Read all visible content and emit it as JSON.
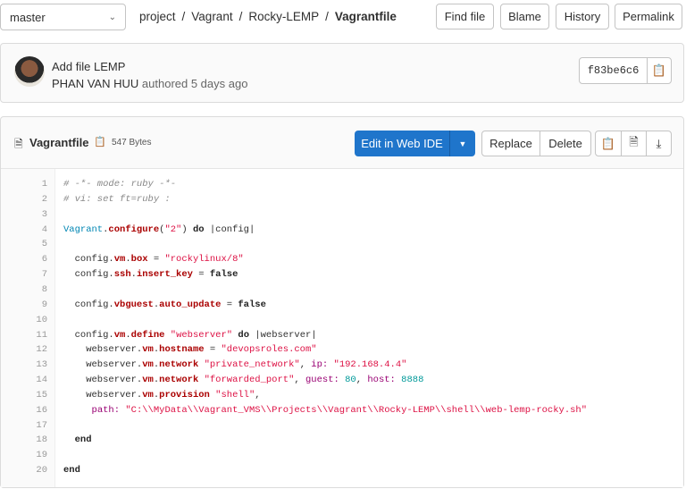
{
  "branch": {
    "value": "master"
  },
  "breadcrumb": [
    "project",
    "Vagrant",
    "Rocky-LEMP",
    "Vagrantfile"
  ],
  "toolbar": {
    "find_file": "Find file",
    "blame": "Blame",
    "history": "History",
    "permalink": "Permalink"
  },
  "commit": {
    "title": "Add file LEMP",
    "author": "PHAN VAN HUU",
    "meta": "authored 5 days ago",
    "sha": "f83be6c6"
  },
  "file": {
    "name": "Vagrantfile",
    "size": "547 Bytes",
    "edit_label": "Edit in Web IDE",
    "replace_label": "Replace",
    "delete_label": "Delete"
  },
  "code": {
    "lines": [
      [
        [
          "c",
          "# -*- mode: ruby -*-"
        ]
      ],
      [
        [
          "c",
          "# vi: set ft=ruby :"
        ]
      ],
      [],
      [
        [
          "n",
          "Vagrant"
        ],
        [
          "p",
          "."
        ],
        [
          "m",
          "configure"
        ],
        [
          "p",
          "("
        ],
        [
          "s",
          "\"2\""
        ],
        [
          "p",
          ") "
        ],
        [
          "k",
          "do"
        ],
        [
          "p",
          " |config|"
        ]
      ],
      [],
      [
        [
          "p",
          "  config."
        ],
        [
          "m",
          "vm"
        ],
        [
          "p",
          "."
        ],
        [
          "m",
          "box"
        ],
        [
          "p",
          " = "
        ],
        [
          "s",
          "\"rockylinux/8\""
        ]
      ],
      [
        [
          "p",
          "  config."
        ],
        [
          "m",
          "ssh"
        ],
        [
          "p",
          "."
        ],
        [
          "m",
          "insert_key"
        ],
        [
          "p",
          " = "
        ],
        [
          "k",
          "false"
        ]
      ],
      [],
      [
        [
          "p",
          "  config."
        ],
        [
          "m",
          "vbguest"
        ],
        [
          "p",
          "."
        ],
        [
          "m",
          "auto_update"
        ],
        [
          "p",
          " = "
        ],
        [
          "k",
          "false"
        ]
      ],
      [],
      [
        [
          "p",
          "  config."
        ],
        [
          "m",
          "vm"
        ],
        [
          "p",
          "."
        ],
        [
          "m",
          "define"
        ],
        [
          "p",
          " "
        ],
        [
          "s",
          "\"webserver\""
        ],
        [
          "p",
          " "
        ],
        [
          "k",
          "do"
        ],
        [
          "p",
          " |webserver|"
        ]
      ],
      [
        [
          "p",
          "    webserver."
        ],
        [
          "m",
          "vm"
        ],
        [
          "p",
          "."
        ],
        [
          "m",
          "hostname"
        ],
        [
          "p",
          " = "
        ],
        [
          "s",
          "\"devopsroles.com\""
        ]
      ],
      [
        [
          "p",
          "    webserver."
        ],
        [
          "m",
          "vm"
        ],
        [
          "p",
          "."
        ],
        [
          "m",
          "network"
        ],
        [
          "p",
          " "
        ],
        [
          "s",
          "\"private_network\""
        ],
        [
          "p",
          ", "
        ],
        [
          "y",
          "ip:"
        ],
        [
          "p",
          " "
        ],
        [
          "s",
          "\"192.168.4.4\""
        ]
      ],
      [
        [
          "p",
          "    webserver."
        ],
        [
          "m",
          "vm"
        ],
        [
          "p",
          "."
        ],
        [
          "m",
          "network"
        ],
        [
          "p",
          " "
        ],
        [
          "s",
          "\"forwarded_port\""
        ],
        [
          "p",
          ", "
        ],
        [
          "y",
          "guest:"
        ],
        [
          "p",
          " "
        ],
        [
          "d",
          "80"
        ],
        [
          "p",
          ", "
        ],
        [
          "y",
          "host:"
        ],
        [
          "p",
          " "
        ],
        [
          "d",
          "8888"
        ]
      ],
      [
        [
          "p",
          "    webserver."
        ],
        [
          "m",
          "vm"
        ],
        [
          "p",
          "."
        ],
        [
          "m",
          "provision"
        ],
        [
          "p",
          " "
        ],
        [
          "s",
          "\"shell\""
        ],
        [
          "p",
          ","
        ]
      ],
      [
        [
          "p",
          "     "
        ],
        [
          "y",
          "path:"
        ],
        [
          "p",
          " "
        ],
        [
          "s",
          "\"C:\\\\MyData\\\\Vagrant_VMS\\\\Projects\\\\Vagrant\\\\Rocky-LEMP\\\\shell\\\\web-lemp-rocky.sh\""
        ]
      ],
      [],
      [
        [
          "k",
          "  end"
        ]
      ],
      [],
      [
        [
          "k",
          "end"
        ]
      ]
    ]
  }
}
